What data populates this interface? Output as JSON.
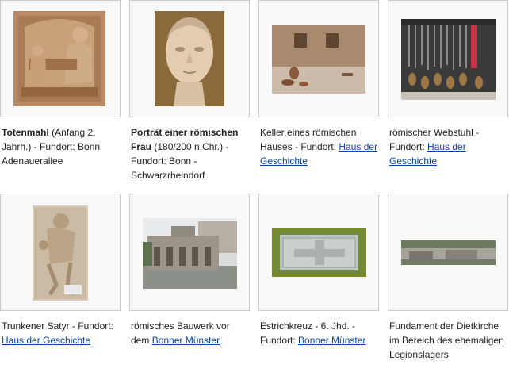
{
  "gallery": {
    "items": [
      {
        "image_name": "totenmahl-relief",
        "title": "Totenmahl",
        "text_before": " (Anfang 2. Jahrh.) - Fundort: Bonn Adenauerallee",
        "link": ""
      },
      {
        "image_name": "portrait-roman-woman",
        "title": "Porträt einer römischen Frau",
        "text_before": " (180/200 n.Chr.) - Fundort: Bonn - Schwarzrheindorf",
        "link": ""
      },
      {
        "image_name": "roman-house-cellar",
        "title": "",
        "text_before": "Keller eines römischen Hauses - Fundort: ",
        "link": "Haus der Geschichte"
      },
      {
        "image_name": "roman-loom",
        "title": "",
        "text_before": "römischer Webstuhl - Fundort: ",
        "link": "Haus der Geschichte"
      },
      {
        "image_name": "drunken-satyr-relief",
        "title": "",
        "text_before": "Trunkener Satyr - Fundort: ",
        "link": "Haus der Geschichte"
      },
      {
        "image_name": "roman-building-ruin",
        "title": "",
        "text_before": "römisches Bauwerk vor dem ",
        "link": "Bonner Münster"
      },
      {
        "image_name": "floor-cross-mosaic",
        "title": "",
        "text_before": "Estrichkreuz - 6. Jhd. - Fundort: ",
        "link": "Bonner Münster"
      },
      {
        "image_name": "dietkirche-foundation",
        "title": "",
        "text_before": "Fundament der Dietkirche im Bereich des ehemaligen Legionslagers",
        "link": ""
      }
    ]
  }
}
